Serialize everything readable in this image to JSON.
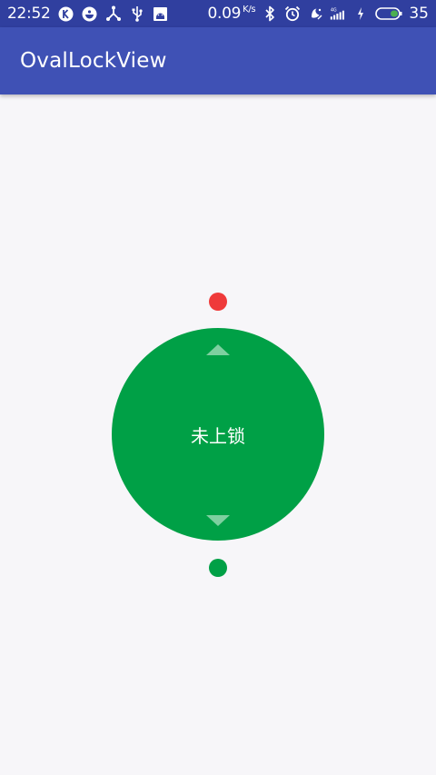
{
  "status_bar": {
    "time": "22:52",
    "net_speed": "0.09",
    "net_unit": "K/s",
    "battery": "35",
    "left_icons": [
      "k-app-icon",
      "app-icon",
      "network-share-icon",
      "usb-icon",
      "android-icon"
    ],
    "right_icons": [
      "bluetooth-icon",
      "alarm-icon",
      "do-not-disturb-icon",
      "signal-4g-icon",
      "charging-icon",
      "battery-icon"
    ]
  },
  "app_bar": {
    "title": "OvalLockView"
  },
  "lock_view": {
    "status_label": "未上锁",
    "circle_color": "#00a046",
    "top_dot_color": "#ef3a3a",
    "bottom_dot_color": "#00a046",
    "arrow_color": "#7ed0a0"
  },
  "colors": {
    "status_bar": "#303f9f",
    "app_bar": "#3f51b5",
    "background": "#f7f6f9"
  }
}
